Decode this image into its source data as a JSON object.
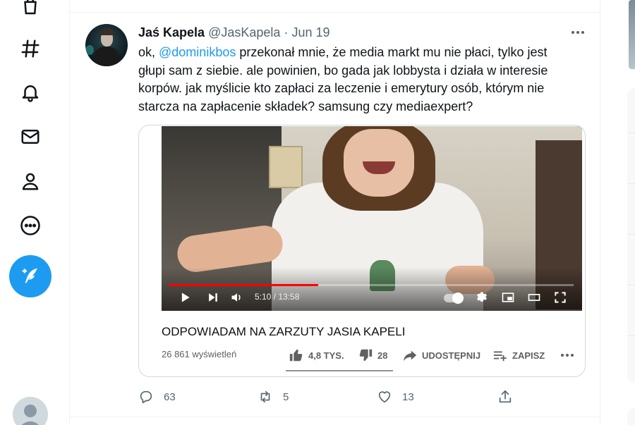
{
  "nav": {
    "items": [
      {
        "icon": "bookmark-bag-icon"
      },
      {
        "icon": "hashtag-icon"
      },
      {
        "icon": "bell-icon"
      },
      {
        "icon": "mail-icon"
      },
      {
        "icon": "profile-icon"
      },
      {
        "icon": "more-circle-icon"
      }
    ],
    "compose_icon": "feather-plus-icon"
  },
  "tweet": {
    "author_name": "Jaś Kapela",
    "author_handle": "@JasKapela",
    "separator": "·",
    "date": "Jun 19",
    "text_before": "ok, ",
    "mention": "@dominikbos",
    "text_after": " przekonał mnie, że media markt mu nie płaci, tylko jest głupi sam z siebie. ale powinien, bo gada jak lobbysta i działa w interesie korpów. jak myślicie kto zapłaci za leczenie i emerytury osób, którym nie starcza na zapłacenie składek? samsung czy mediaexpert?",
    "replies": "63",
    "retweets": "5",
    "likes": "13"
  },
  "video": {
    "time": "5:10 / 13:58",
    "progress": 0.37,
    "progress_color": "#ff0000",
    "title": "ODPOWIADAM NA ZARZUTY JASIA KAPELI",
    "views": "26 861 wyświetleń",
    "likes": "4,8 TYS.",
    "dislikes": "28",
    "share_label": "UDOSTĘPNIJ",
    "save_label": "ZAPISZ"
  },
  "colors": {
    "accent": "#1d9bf0",
    "text": "#0f1419",
    "muted": "#536471"
  }
}
